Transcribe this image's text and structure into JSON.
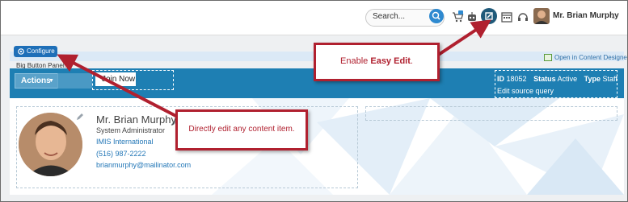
{
  "header": {
    "search_placeholder": "Search...",
    "user_name": "Mr. Brian Murphy"
  },
  "toolbar": {
    "configure_label": "Configure",
    "open_in_designer": "Open in Content Designer",
    "panel_label": "Big Button Panel: A"
  },
  "big_button_panel": {
    "actions_label": "Actions",
    "join_label": "Join Now",
    "id_label": "ID",
    "id_value": "18052",
    "status_label": "Status",
    "status_value": "Active",
    "type_label": "Type",
    "type_value": "Staff",
    "edit_source": "Edit source query"
  },
  "profile": {
    "name": "Mr. Brian Murphy",
    "role": "System Administrator",
    "organization": "IMIS International",
    "phone": "(516) 987-2222",
    "email": "brianmurphy@mailinator.com"
  },
  "callouts": {
    "easy_edit_prefix": "Enable ",
    "easy_edit_bold": "Easy Edit",
    "easy_edit_suffix": ".",
    "direct_edit": "Directly edit any content item."
  },
  "colors": {
    "accent": "#1e7fb3",
    "callout": "#b0202f",
    "link": "#2377b7"
  },
  "icons": [
    "search-icon",
    "cart-icon",
    "robot-icon",
    "easy-edit-icon",
    "calendar-icon",
    "headset-icon",
    "gear-icon",
    "pencil-icon"
  ]
}
